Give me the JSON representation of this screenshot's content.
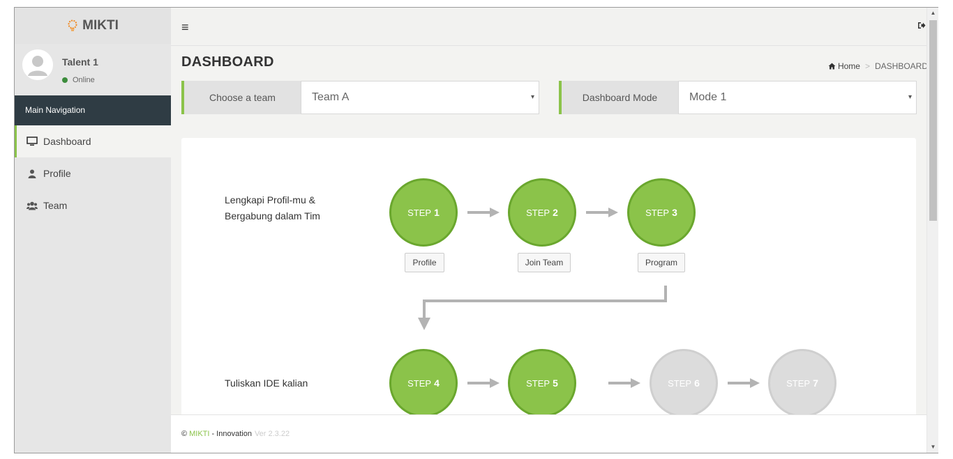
{
  "brand": {
    "name": "MIKTI"
  },
  "user": {
    "name": "Talent 1",
    "status": "Online"
  },
  "sidebar": {
    "section_label": "Main Navigation",
    "items": [
      {
        "label": "Dashboard",
        "icon": "monitor-icon",
        "active": true
      },
      {
        "label": "Profile",
        "icon": "user-icon",
        "active": false
      },
      {
        "label": "Team",
        "icon": "users-icon",
        "active": false
      }
    ]
  },
  "header": {
    "menu_icon": "hamburger-icon",
    "signout_icon": "sign-out-icon"
  },
  "page": {
    "title": "DASHBOARD",
    "breadcrumb": {
      "home": "Home",
      "current": "DASHBOARD"
    }
  },
  "selectors": {
    "team": {
      "label": "Choose a team",
      "value": "Team A"
    },
    "mode": {
      "label": "Dashboard Mode",
      "value": "Mode 1"
    }
  },
  "steps": {
    "row1_label_line1": "Lengkapi Profil-mu &",
    "row1_label_line2": "Bergabung dalam Tim",
    "row2_label": "Tuliskan IDE kalian",
    "prefix": "STEP",
    "items": [
      {
        "num": "1",
        "done": true,
        "button": "Profile"
      },
      {
        "num": "2",
        "done": true,
        "button": "Join Team"
      },
      {
        "num": "3",
        "done": true,
        "button": "Program"
      },
      {
        "num": "4",
        "done": true
      },
      {
        "num": "5",
        "done": true
      },
      {
        "num": "6",
        "done": false
      },
      {
        "num": "7",
        "done": false
      }
    ]
  },
  "footer": {
    "copyright": "©",
    "brand": "MIKTI",
    "text": "- Innovation",
    "version": "Ver 2.3.22"
  },
  "colors": {
    "accent": "#8bc34a",
    "accent_dark": "#6aa72e",
    "nav_dark": "#2f3c44",
    "inactive": "#dcdcdc"
  }
}
